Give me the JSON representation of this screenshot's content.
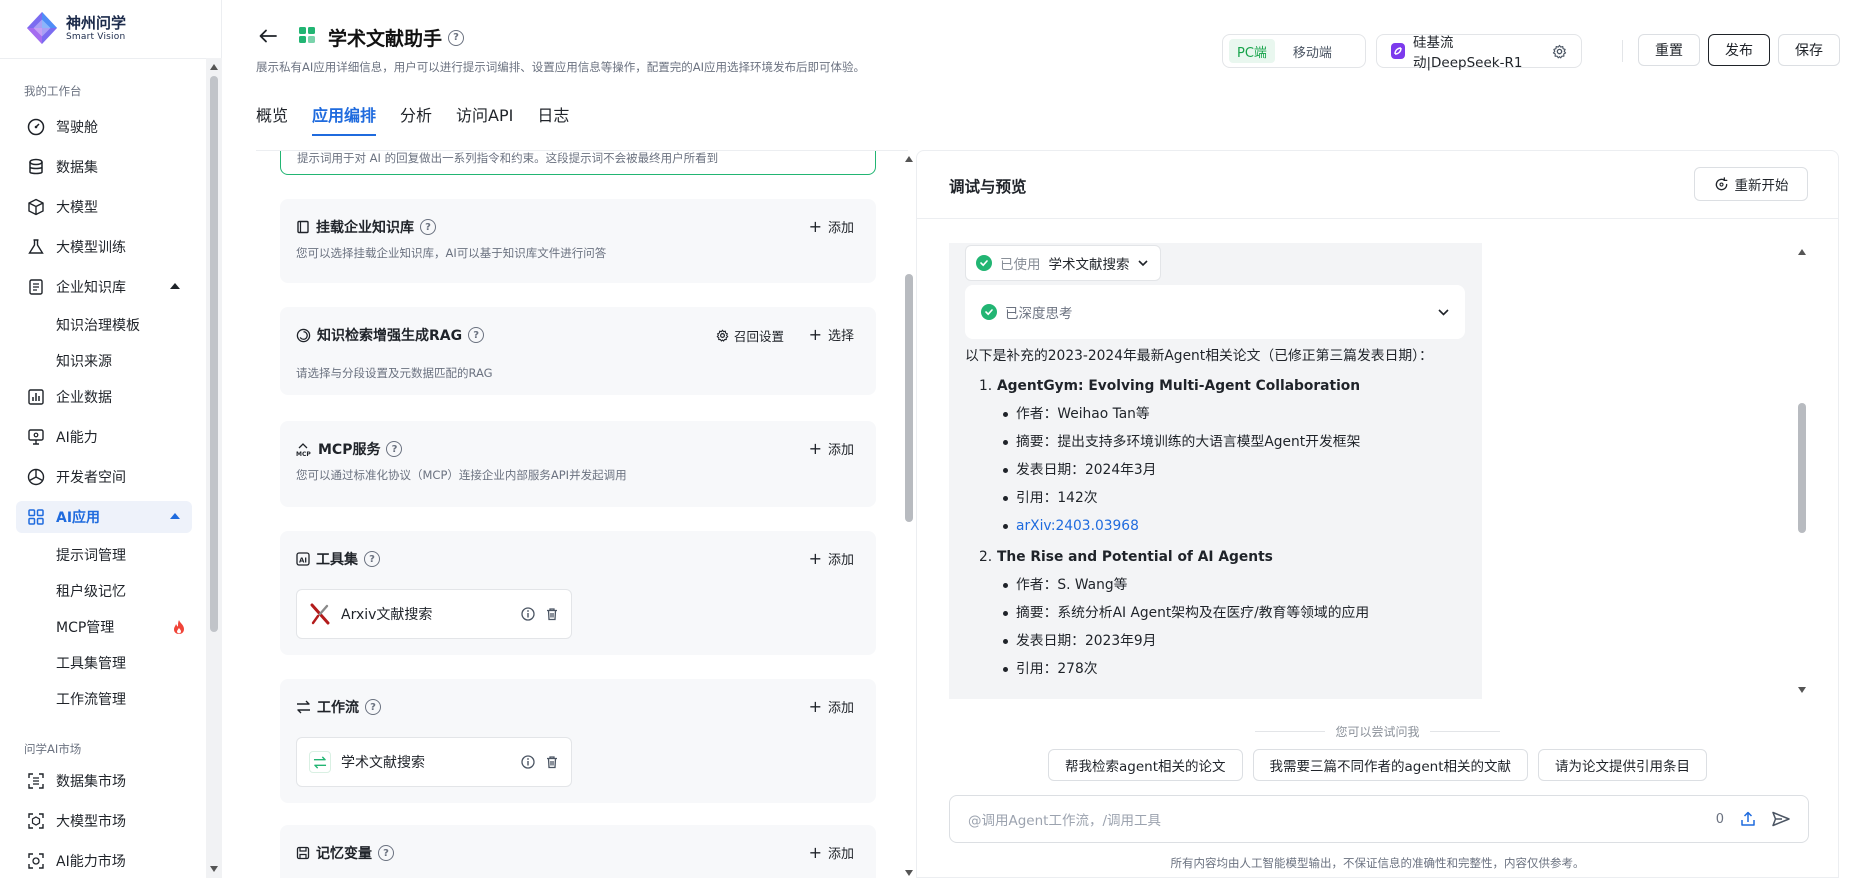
{
  "brand": {
    "name_cn": "神州问学",
    "name_en": "Smart Vision"
  },
  "sidebar": {
    "group1": "我的工作台",
    "items": [
      {
        "label": "驾驶舱"
      },
      {
        "label": "数据集"
      },
      {
        "label": "大模型"
      },
      {
        "label": "大模型训练"
      },
      {
        "label": "企业知识库"
      },
      {
        "label": "企业数据"
      },
      {
        "label": "AI能力"
      },
      {
        "label": "开发者空间"
      },
      {
        "label": "AI应用"
      }
    ],
    "kb_sub": [
      "知识治理模板",
      "知识来源"
    ],
    "app_sub": [
      "提示词管理",
      "租户级记忆",
      "MCP管理",
      "工具集管理",
      "工作流管理"
    ],
    "group2": "问学AI市场",
    "market": [
      {
        "label": "数据集市场"
      },
      {
        "label": "大模型市场"
      },
      {
        "label": "AI能力市场"
      }
    ]
  },
  "header": {
    "title": "学术文献助手",
    "description": "展示私有AI应用详细信息，用户可以进行提示词编排、设置应用信息等操作，配置完的AI应用选择环境发布后即可体验。",
    "tabs": [
      "概览",
      "应用编排",
      "分析",
      "访问API",
      "日志"
    ],
    "active_tab": "应用编排",
    "platform": {
      "pc": "PC端",
      "mobile": "移动端"
    },
    "model": "硅基流动|DeepSeek-R1",
    "buttons": {
      "reset": "重置",
      "publish": "发布",
      "save": "保存"
    }
  },
  "config": {
    "prompt_hint": "提示词用于对 AI 的回复做出一系列指令和约束。这段提示词不会被最终用户所看到",
    "cards": {
      "kb": {
        "title": "挂载企业知识库",
        "desc": "您可以选择挂载企业知识库，AI可以基于知识库文件进行问答",
        "action": "添加"
      },
      "rag": {
        "title": "知识检索增强生成RAG",
        "desc": "请选择与分段设置及元数据匹配的RAG",
        "recall": "召回设置",
        "action": "选择"
      },
      "mcp": {
        "title": "MCP服务",
        "desc": "您可以通过标准化协议（MCP）连接企业内部服务API并发起调用",
        "action": "添加"
      },
      "tools": {
        "title": "工具集",
        "action": "添加",
        "item": "Arxiv文献搜索"
      },
      "workflow": {
        "title": "工作流",
        "action": "添加",
        "item": "学术文献搜索"
      },
      "memory": {
        "title": "记忆变量",
        "action": "添加"
      }
    }
  },
  "preview": {
    "title": "调试与预览",
    "restart": "重新开始",
    "used_label": "已使用",
    "used_tool": "学术文献搜索",
    "thinking": "已深度思考",
    "intro": "以下是补充的2023-2024年最新Agent相关论文（已修正第三篇发表日期）：",
    "papers": [
      {
        "num": "1.",
        "title": "AgentGym: Evolving Multi-Agent Collaboration",
        "author": "作者：Weihao Tan等",
        "abstract": "摘要：提出支持多环境训练的大语言模型Agent开发框架",
        "date": "发表日期：2024年3月",
        "cites": "引用：142次",
        "link": "arXiv:2403.03968"
      },
      {
        "num": "2.",
        "title": "The Rise and Potential of AI Agents",
        "author": "作者：S. Wang等",
        "abstract": "摘要：系统分析AI Agent架构及在医疗/教育等领域的应用",
        "date": "发表日期：2023年9月",
        "cites": "引用：278次"
      }
    ],
    "suggest_label": "您可以尝试问我",
    "suggestions": [
      "帮我检索agent相关的论文",
      "我需要三篇不同作者的agent相关的文献",
      "请为论文提供引用条目"
    ],
    "input_placeholder": "@调用Agent工作流，/调用工具",
    "char_count": "0",
    "disclaimer": "所有内容均由人工智能模型输出，不保证信息的准确性和完整性，内容仅供参考。"
  }
}
